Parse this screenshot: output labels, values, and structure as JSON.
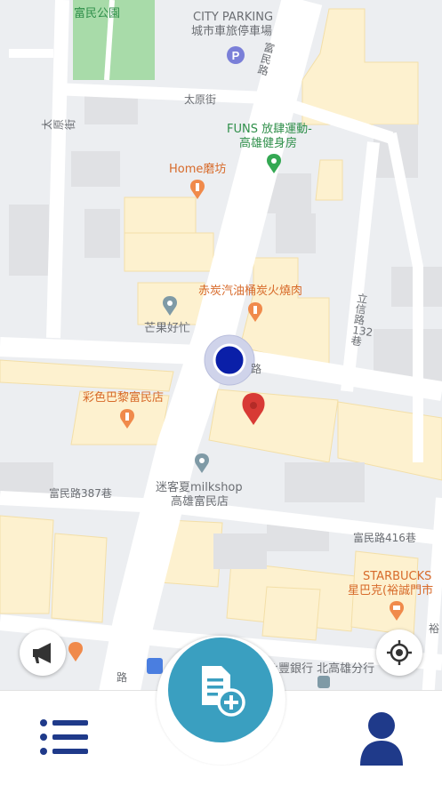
{
  "map": {
    "streets": {
      "fumin_rd": "富民路",
      "taiyuan_st": "太原街",
      "taiyuan_st_2": "太原街",
      "lixin_rd_132": "立信路132巷",
      "fumin_rd_387": "富民路387巷",
      "fumin_rd_416": "富民路416巷",
      "bottom_road": "路",
      "mid_road": "路",
      "right_edge_road": "裕"
    },
    "places": {
      "park": "富民公園",
      "parking_en": "CITY PARKING",
      "parking_zh": "城市車旅停車場",
      "funs_line1": "FUNS 放肆運動-",
      "funs_line2": "高雄健身房",
      "home_mofang": "Home磨坊",
      "chitan": "赤炭汽油桶炭火燒肉",
      "mangguo": "芒果好忙",
      "caise": "彩色巴黎富民店",
      "mikexia_line1": "迷客夏milkshop",
      "mikexia_line2": "高雄富民店",
      "starbucks_en": "STARBUCKS",
      "starbucks_zh": "星巴克(裕誠門市",
      "bank": "永豐銀行 北高雄分行"
    },
    "colors": {
      "road": "#ffffff",
      "block": "#e9eaec",
      "building": "#fdf1cf",
      "park": "#a6d9a7",
      "user_dot": "#0a1fa8",
      "marker": "#d83a35",
      "poi_orange": "#f08a4b",
      "poi_gray": "#7f9aa6",
      "poi_green": "#34a853",
      "poi_blue": "#4a7ee0"
    }
  },
  "controls": {
    "announce_icon": "megaphone-icon",
    "locate_icon": "crosshair-locate-icon"
  },
  "bottom_nav": {
    "list_icon": "list-icon",
    "add_report_icon": "document-plus-icon",
    "profile_icon": "user-icon",
    "accent": "#3a9fc0",
    "dark": "#1f3a8a"
  }
}
